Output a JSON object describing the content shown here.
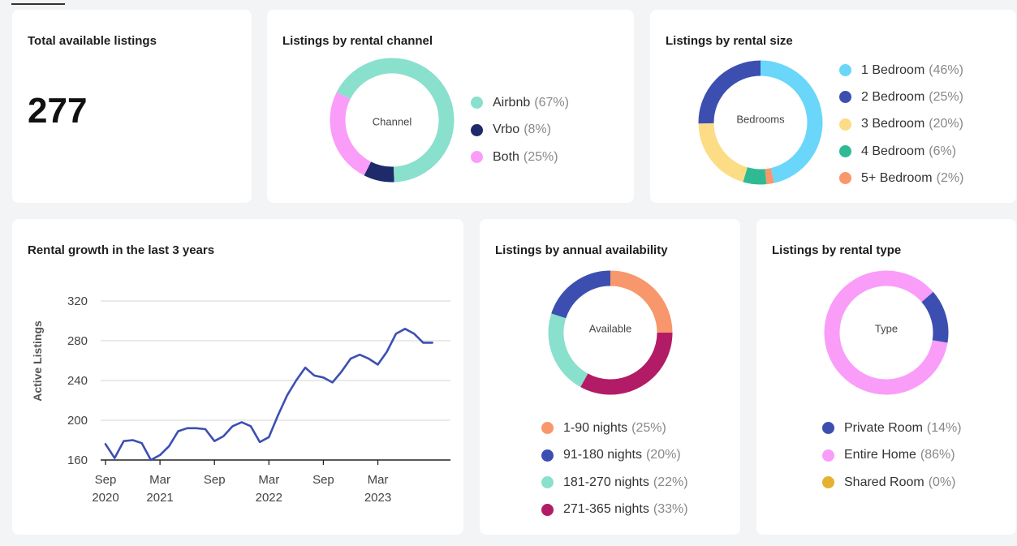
{
  "total_listings": {
    "title": "Total available listings",
    "value": "277"
  },
  "chart_data": [
    {
      "id": "channel",
      "type": "pie",
      "title": "Listings by rental channel",
      "center_label": "Channel",
      "start_angle": 88,
      "slices": [
        {
          "label": "Airbnb",
          "pct_label": "(67%)",
          "value": 67,
          "color": "#89e0cc"
        },
        {
          "label": "Vrbo",
          "pct_label": "(8%)",
          "value": 8,
          "color": "#1f2a6a"
        },
        {
          "label": "Both",
          "pct_label": "(25%)",
          "value": 25,
          "color": "#f99df9"
        }
      ],
      "draw_order": [
        1,
        2,
        0
      ]
    },
    {
      "id": "size",
      "type": "pie",
      "title": "Listings by rental size",
      "center_label": "Bedrooms",
      "start_angle": -90,
      "slices": [
        {
          "label": "1 Bedroom",
          "pct_label": "(46%)",
          "value": 46,
          "color": "#69d6fa"
        },
        {
          "label": "2 Bedroom",
          "pct_label": "(25%)",
          "value": 25,
          "color": "#3c4fb1"
        },
        {
          "label": "3 Bedroom",
          "pct_label": "(20%)",
          "value": 20,
          "color": "#fddc86"
        },
        {
          "label": "4 Bedroom",
          "pct_label": "(6%)",
          "value": 6,
          "color": "#2fba94"
        },
        {
          "label": "5+ Bedroom",
          "pct_label": "(2%)",
          "value": 2,
          "color": "#f8976c"
        }
      ],
      "draw_order": [
        0,
        4,
        3,
        2,
        1
      ]
    },
    {
      "id": "growth",
      "type": "line",
      "title": "Rental growth in the last 3 years",
      "ylabel": "Active Listings",
      "ylim": [
        160,
        320
      ],
      "yticks": [
        160,
        200,
        240,
        280,
        320
      ],
      "xlim": [
        "2020-09",
        "2023-11"
      ],
      "xticks": [
        {
          "month": "2020-09",
          "label": "Sep",
          "year": "2020"
        },
        {
          "month": "2021-03",
          "label": "Mar",
          "year": "2021"
        },
        {
          "month": "2021-09",
          "label": "Sep",
          "year": ""
        },
        {
          "month": "2022-03",
          "label": "Mar",
          "year": "2022"
        },
        {
          "month": "2022-09",
          "label": "Sep",
          "year": ""
        },
        {
          "month": "2023-03",
          "label": "Mar",
          "year": "2023"
        }
      ],
      "grid": true,
      "color": "#3d4fb3",
      "x": [
        "2020-09",
        "2020-10",
        "2020-11",
        "2020-12",
        "2021-01",
        "2021-02",
        "2021-03",
        "2021-04",
        "2021-05",
        "2021-06",
        "2021-07",
        "2021-08",
        "2021-09",
        "2021-10",
        "2021-11",
        "2021-12",
        "2022-01",
        "2022-02",
        "2022-03",
        "2022-04",
        "2022-05",
        "2022-06",
        "2022-07",
        "2022-08",
        "2022-09",
        "2022-10",
        "2022-11",
        "2022-12",
        "2023-01",
        "2023-02",
        "2023-03",
        "2023-04",
        "2023-05",
        "2023-06",
        "2023-07",
        "2023-08",
        "2023-09",
        "2023-10",
        "2023-11"
      ],
      "values": [
        176,
        162,
        179,
        180,
        177,
        160,
        165,
        174,
        189,
        192,
        192,
        191,
        179,
        184,
        194,
        198,
        194,
        178,
        183,
        205,
        225,
        240,
        253,
        245,
        243,
        238,
        249,
        262,
        266,
        262,
        256,
        269,
        287,
        292,
        287,
        278,
        278,
        278,
        278
      ]
    },
    {
      "id": "availability",
      "type": "pie",
      "title": "Listings by annual availability",
      "center_label": "Available",
      "start_angle": -90,
      "slices": [
        {
          "label": "1-90 nights",
          "pct_label": "(25%)",
          "value": 25,
          "color": "#f8976c"
        },
        {
          "label": "91-180 nights",
          "pct_label": "(20%)",
          "value": 20,
          "color": "#3c4fb1"
        },
        {
          "label": "181-270 nights",
          "pct_label": "(22%)",
          "value": 22,
          "color": "#89e0cc"
        },
        {
          "label": "271-365 nights",
          "pct_label": "(33%)",
          "value": 33,
          "color": "#b21c66"
        }
      ],
      "draw_order": [
        0,
        3,
        2,
        1
      ]
    },
    {
      "id": "type",
      "type": "pie",
      "title": "Listings by rental type",
      "center_label": "Type",
      "start_angle": -41,
      "slices": [
        {
          "label": "Private Room",
          "pct_label": "(14%)",
          "value": 14,
          "color": "#3c4fb1"
        },
        {
          "label": "Entire Home",
          "pct_label": "(86%)",
          "value": 86,
          "color": "#f99df9"
        },
        {
          "label": "Shared Room",
          "pct_label": "(0%)",
          "value": 0,
          "color": "#e4b22e"
        }
      ],
      "draw_order": [
        0,
        1,
        2
      ]
    }
  ]
}
